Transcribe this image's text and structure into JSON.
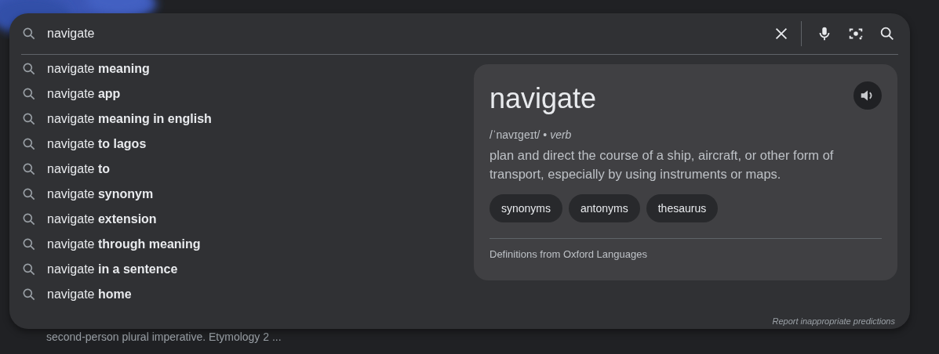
{
  "search": {
    "value": "navigate"
  },
  "suggestions": [
    {
      "text": "navigate **meaning**"
    },
    {
      "text": "navigate **app**"
    },
    {
      "text": "navigate **meaning in english**"
    },
    {
      "text": "navigate **to lagos**"
    },
    {
      "text": "navigate **to**"
    },
    {
      "text": "navigate **synonym**"
    },
    {
      "text": "navigate **extension**"
    },
    {
      "text": "navigate **through meaning**"
    },
    {
      "text": "navigate **in a sentence**"
    },
    {
      "text": "navigate **home**"
    }
  ],
  "definition": {
    "word": "navigate",
    "pronunciation": "/ˈnavɪɡeɪt/ • *verb*",
    "meaning": "plan and direct the course of a ship, aircraft, or other form of transport, especially by using instruments or maps.",
    "chips": [
      "synonyms",
      "antonyms",
      "thesaurus"
    ],
    "source": "Definitions from Oxford Languages"
  },
  "report_link": "Report inappropriate predictions",
  "background_snippet": "second-person plural imperative. Etymology 2 ..."
}
